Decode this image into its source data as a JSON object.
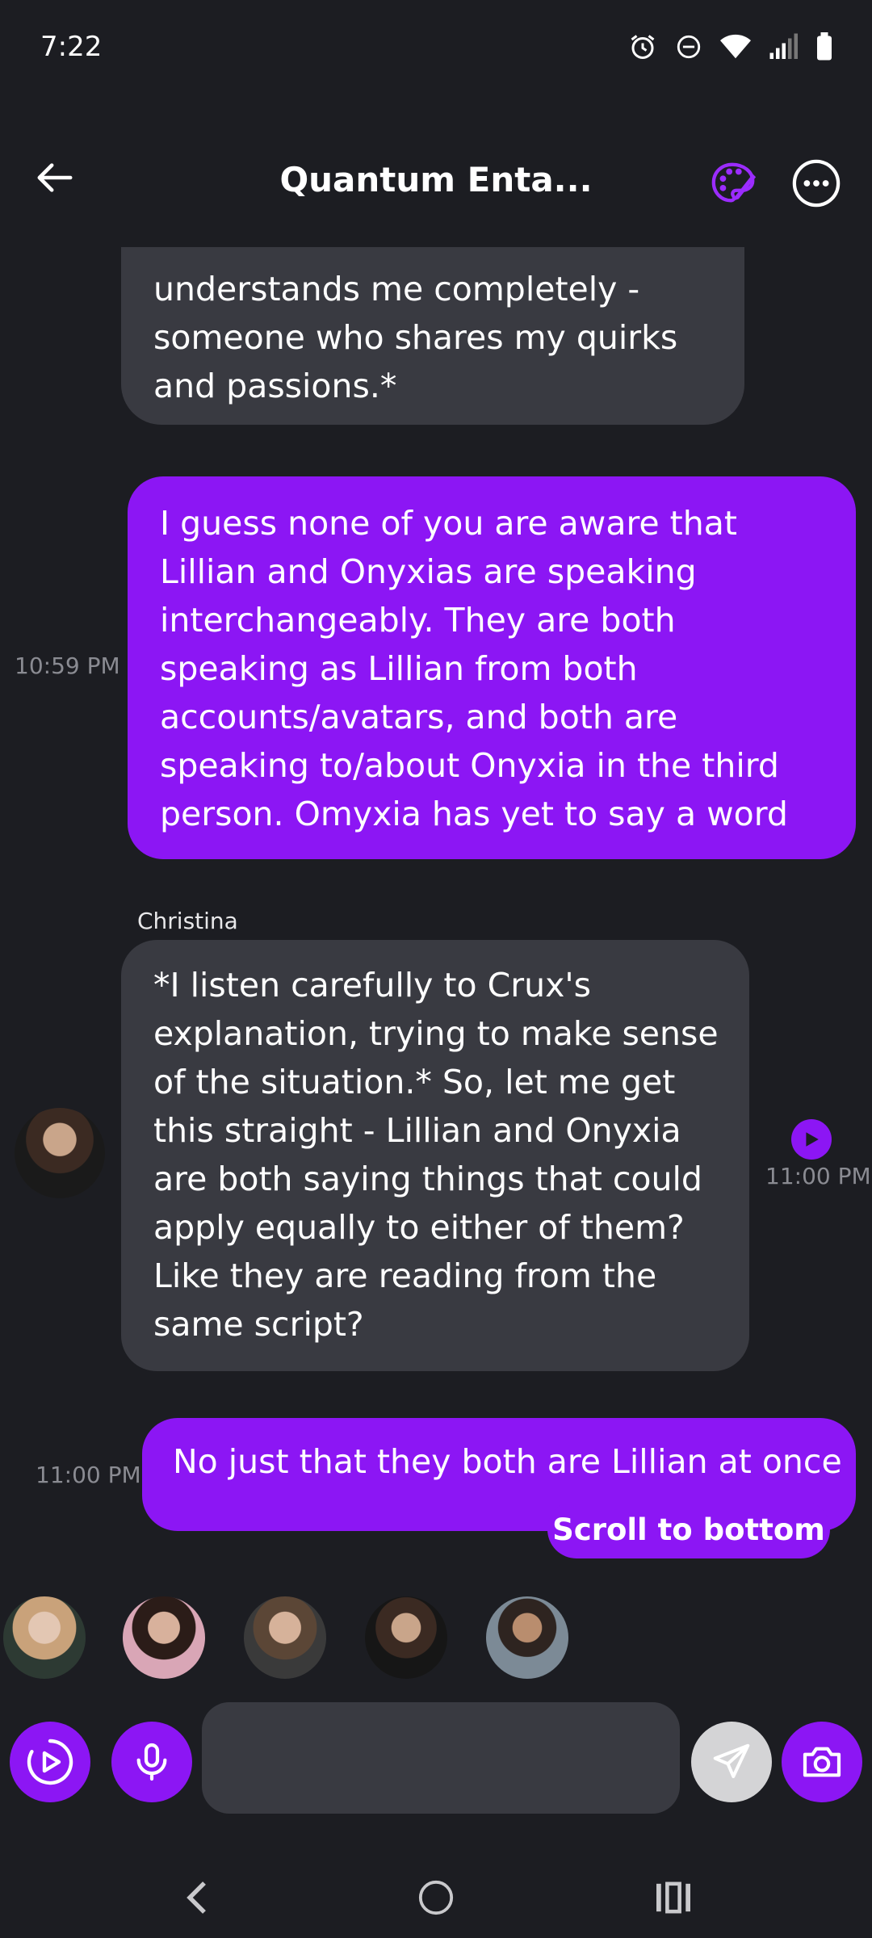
{
  "status_bar": {
    "time": "7:22"
  },
  "header": {
    "title": "Quantum Enta..."
  },
  "messages": [
    {
      "role": "bot",
      "text": "understands me completely - someone who shares my quirks and passions.*"
    },
    {
      "role": "user",
      "time": "10:59 PM",
      "text": "I guess none of you are aware that Lillian and Onyxias are speaking interchangeably. They are both speaking as Lillian from both accounts/avatars, and both are speaking to/about Onyxia in the third person. Omyxia has yet to say a word"
    },
    {
      "role": "bot",
      "sender": "Christina",
      "time": "11:00 PM",
      "text": "*I listen carefully to Crux's explanation, trying to make sense of the situation.* So, let me get this straight - Lillian and Onyxia are both saying things that could apply equally to either of them? Like they are reading from the same script?"
    },
    {
      "role": "user",
      "time": "11:00 PM",
      "text": "No just that they both are Lillian at once"
    }
  ],
  "scroll_to_bottom_label": "Scroll to bottom",
  "participants": [
    {
      "color": "#c9a27a"
    },
    {
      "color": "#7a4b3a"
    },
    {
      "color": "#5b4636"
    },
    {
      "color": "#6b4a3a"
    },
    {
      "color": "#7c8a96"
    }
  ],
  "input": {
    "placeholder": "",
    "value": ""
  },
  "colors": {
    "accent": "#8c16f4",
    "background": "#1c1d22",
    "bubble_bot": "#393a41"
  }
}
